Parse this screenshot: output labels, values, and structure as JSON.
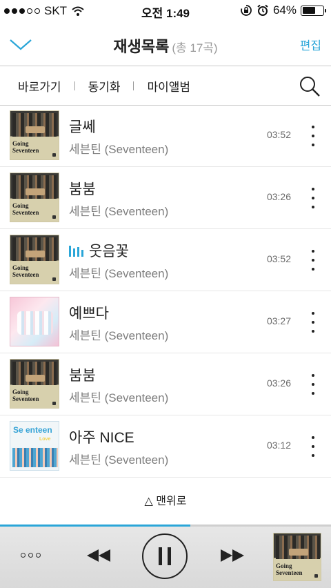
{
  "status_bar": {
    "carrier": "SKT",
    "time": "오전 1:49",
    "battery": "64%",
    "battery_level": 0.64
  },
  "header": {
    "title": "재생목록",
    "count": "(총 17곡)",
    "edit_label": "편집"
  },
  "subnav": {
    "items": [
      "바로가기",
      "동기화",
      "마이앨범"
    ]
  },
  "songs": [
    {
      "title": "글쎄",
      "artist": "세븐틴 (Seventeen)",
      "duration": "03:52",
      "art": "going-seventeen",
      "playing": false
    },
    {
      "title": "붐붐",
      "artist": "세븐틴 (Seventeen)",
      "duration": "03:26",
      "art": "going-seventeen",
      "playing": false
    },
    {
      "title": "웃음꽃",
      "artist": "세븐틴 (Seventeen)",
      "duration": "03:52",
      "art": "going-seventeen",
      "playing": true
    },
    {
      "title": "예쁘다",
      "artist": "세븐틴 (Seventeen)",
      "duration": "03:27",
      "art": "love-and-letter",
      "playing": false
    },
    {
      "title": "붐붐",
      "artist": "세븐틴 (Seventeen)",
      "duration": "03:26",
      "art": "going-seventeen",
      "playing": false
    },
    {
      "title": "아주 NICE",
      "artist": "세븐틴 (Seventeen)",
      "duration": "03:12",
      "art": "seventeen-love",
      "playing": false
    }
  ],
  "album_art_text": {
    "line1": "Going",
    "line2": "Seventeen",
    "nice_logo": "Se enteen",
    "nice_sub": "Love"
  },
  "to_top_label": "△ 맨위로",
  "player": {
    "progress": 0.575,
    "accent_color": "#2aa6d8"
  }
}
